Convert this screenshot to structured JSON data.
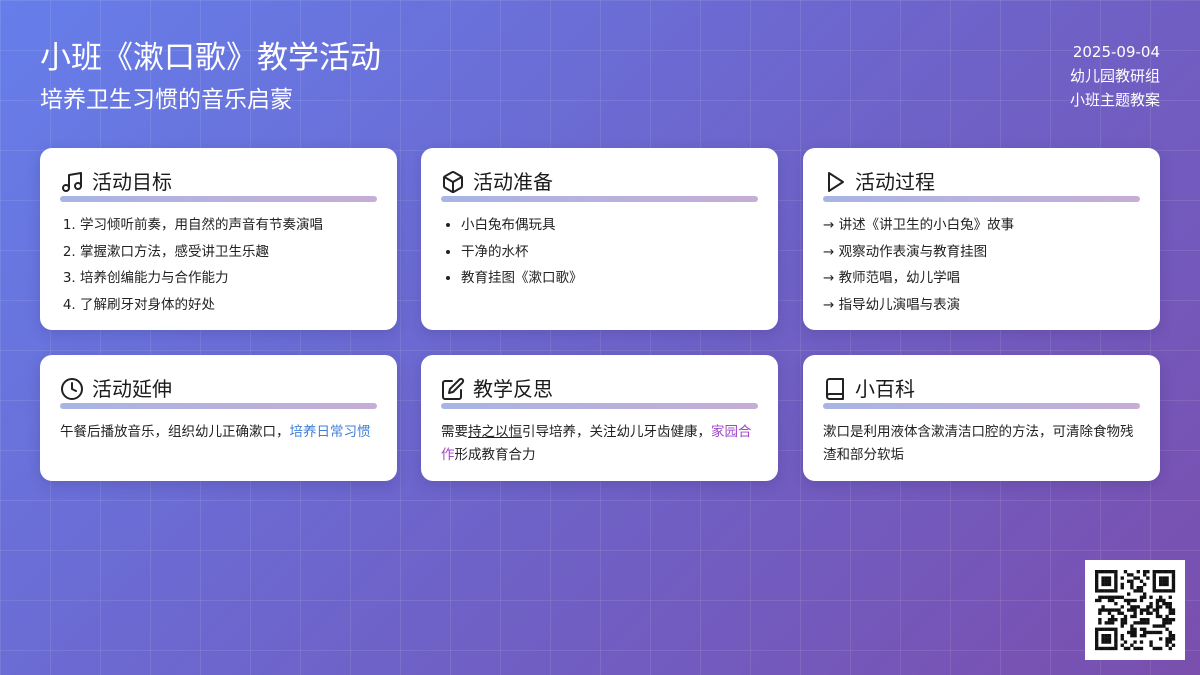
{
  "header": {
    "title": "小班《漱口歌》教学活动",
    "subtitle": "培养卫生习惯的音乐启蒙",
    "date": "2025-09-04",
    "org": "幼儿园教研组",
    "category": "小班主题教案"
  },
  "cards": {
    "goals": {
      "title": "活动目标",
      "icon": "music-note-icon",
      "items": [
        "学习倾听前奏，用自然的声音有节奏演唱",
        "掌握漱口方法，感受讲卫生乐趣",
        "培养创编能力与合作能力",
        "了解刷牙对身体的好处"
      ]
    },
    "prep": {
      "title": "活动准备",
      "icon": "box-icon",
      "items": [
        "小白兔布偶玩具",
        "干净的水杯",
        "教育挂图《漱口歌》"
      ]
    },
    "process": {
      "title": "活动过程",
      "icon": "play-icon",
      "items": [
        "→ 讲述《讲卫生的小白兔》故事",
        "→ 观察动作表演与教育挂图",
        "→ 教师范唱，幼儿学唱",
        "→ 指导幼儿演唱与表演"
      ]
    },
    "extension": {
      "title": "活动延伸",
      "icon": "clock-icon",
      "text_before": "午餐后播放音乐，组织幼儿正确漱口，",
      "text_highlight": "培养日常习惯"
    },
    "reflection": {
      "title": "教学反思",
      "icon": "edit-icon",
      "text_1": "需要",
      "text_underline": "持之以恒",
      "text_2": "引导培养，关注幼儿牙齿健康，",
      "text_highlight": "家园合作",
      "text_3": "形成教育合力"
    },
    "wiki": {
      "title": "小百科",
      "icon": "book-icon",
      "text": "漱口是利用液体含漱清洁口腔的方法，可清除食物残渣和部分软垢"
    }
  },
  "colors": {
    "accent_blue": "#3f7fd8",
    "accent_purple": "#a047c9",
    "bg_start": "#667eea",
    "bg_end": "#7a4fae"
  },
  "qr": {
    "icon": "qr-code-icon"
  }
}
